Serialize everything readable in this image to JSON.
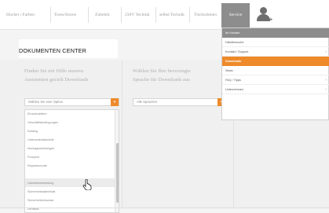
{
  "nav": {
    "items": [
      "Hocher | Farben",
      "Tores/Stores",
      "Zubehör",
      "230V Technik",
      "selbst Technik",
      "Tischrahmen"
    ],
    "active": "Service"
  },
  "page": {
    "title": "DOKUMENTEN CENTER"
  },
  "left": {
    "intro_line1": "Finden Sie mit Hilfe unseres",
    "intro_line2": "Assistenten gezielt Downloads",
    "select_value": "Wählen Sie eine Option",
    "dropdown_items": [
      "Einzelanleitien",
      "Geschäftsbedingungen",
      "Katalog",
      "Lieferantenfaksimile",
      "Montageanleitungen",
      "Prospekt",
      "Reparaturcode",
      "Garantieanmeldung",
      "Sicherheitsdatenblatt",
      "Sicherheitshinweise",
      "Zertifikat"
    ],
    "hover_item_index": 7
  },
  "middle": {
    "intro_line1": "Wählen Sie Ihre bevorzugte",
    "intro_line2": "Sprache für Downloads aus",
    "select_value": "Alle Sprachen"
  },
  "menu": {
    "header": "Ihr Kontakt",
    "items": [
      {
        "label": "Händlersuche",
        "chevron": false
      },
      {
        "label": "Kontakt / Support",
        "chevron": true
      },
      {
        "label": "Downloads",
        "chevron": false,
        "active": true
      },
      {
        "label": "News",
        "chevron": false
      },
      {
        "label": "FAQ / Tipps",
        "chevron": true
      },
      {
        "label": "Unternehmen",
        "chevron": true
      }
    ]
  },
  "icons": {
    "user": "user-plus-icon",
    "chevron": "›",
    "dropdown": "▾"
  },
  "colors": {
    "accent": "#ee8a2a",
    "active_nav": "#8d8d8d"
  }
}
